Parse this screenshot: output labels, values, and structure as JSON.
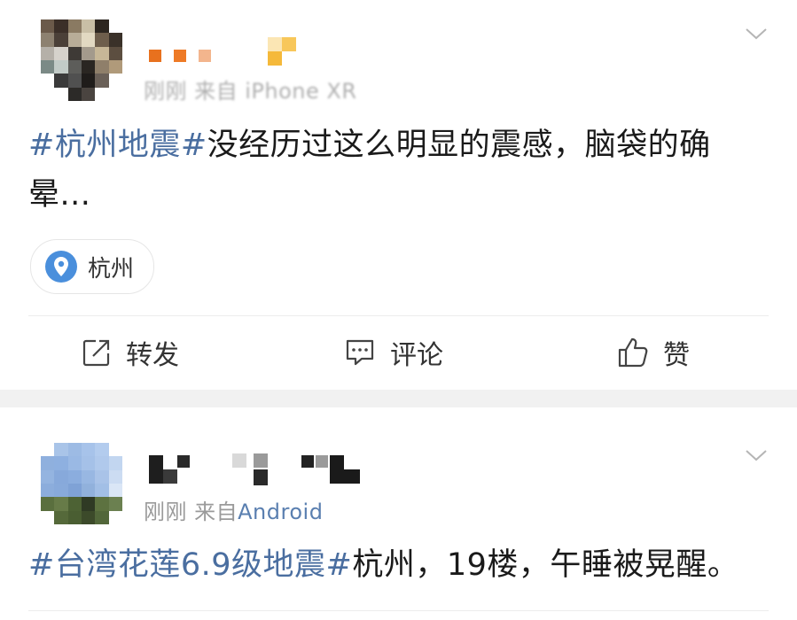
{
  "posts": [
    {
      "meta_time": "刚刚",
      "meta_source": "来自 iPhone XR",
      "content_topic": "#杭州地震#",
      "content_text": "没经历过这么明显的震感，脑袋的确晕...",
      "location": "杭州",
      "icons": {
        "menu": "chevron-down-icon",
        "location": "location-pin-icon"
      }
    },
    {
      "meta_time": "刚刚",
      "meta_source_prefix": "来自",
      "meta_source": "Android",
      "content_topic": "#台湾花莲6.9级地震#",
      "content_text": "杭州，19楼，午睡被晃醒。",
      "icons": {
        "menu": "chevron-down-icon"
      }
    }
  ],
  "actions": {
    "repost_label": "转发",
    "comment_label": "评论",
    "like_label": "赞",
    "icons": {
      "repost": "share-icon",
      "comment": "comment-icon",
      "like": "thumbs-up-icon"
    }
  },
  "colors": {
    "topic_link": "#4a6ea0",
    "source_link": "#5a7fb0",
    "meta_gray": "#9a9a9a",
    "separator_band": "#f1f1f1",
    "location_pin": "#4a8fdc"
  }
}
